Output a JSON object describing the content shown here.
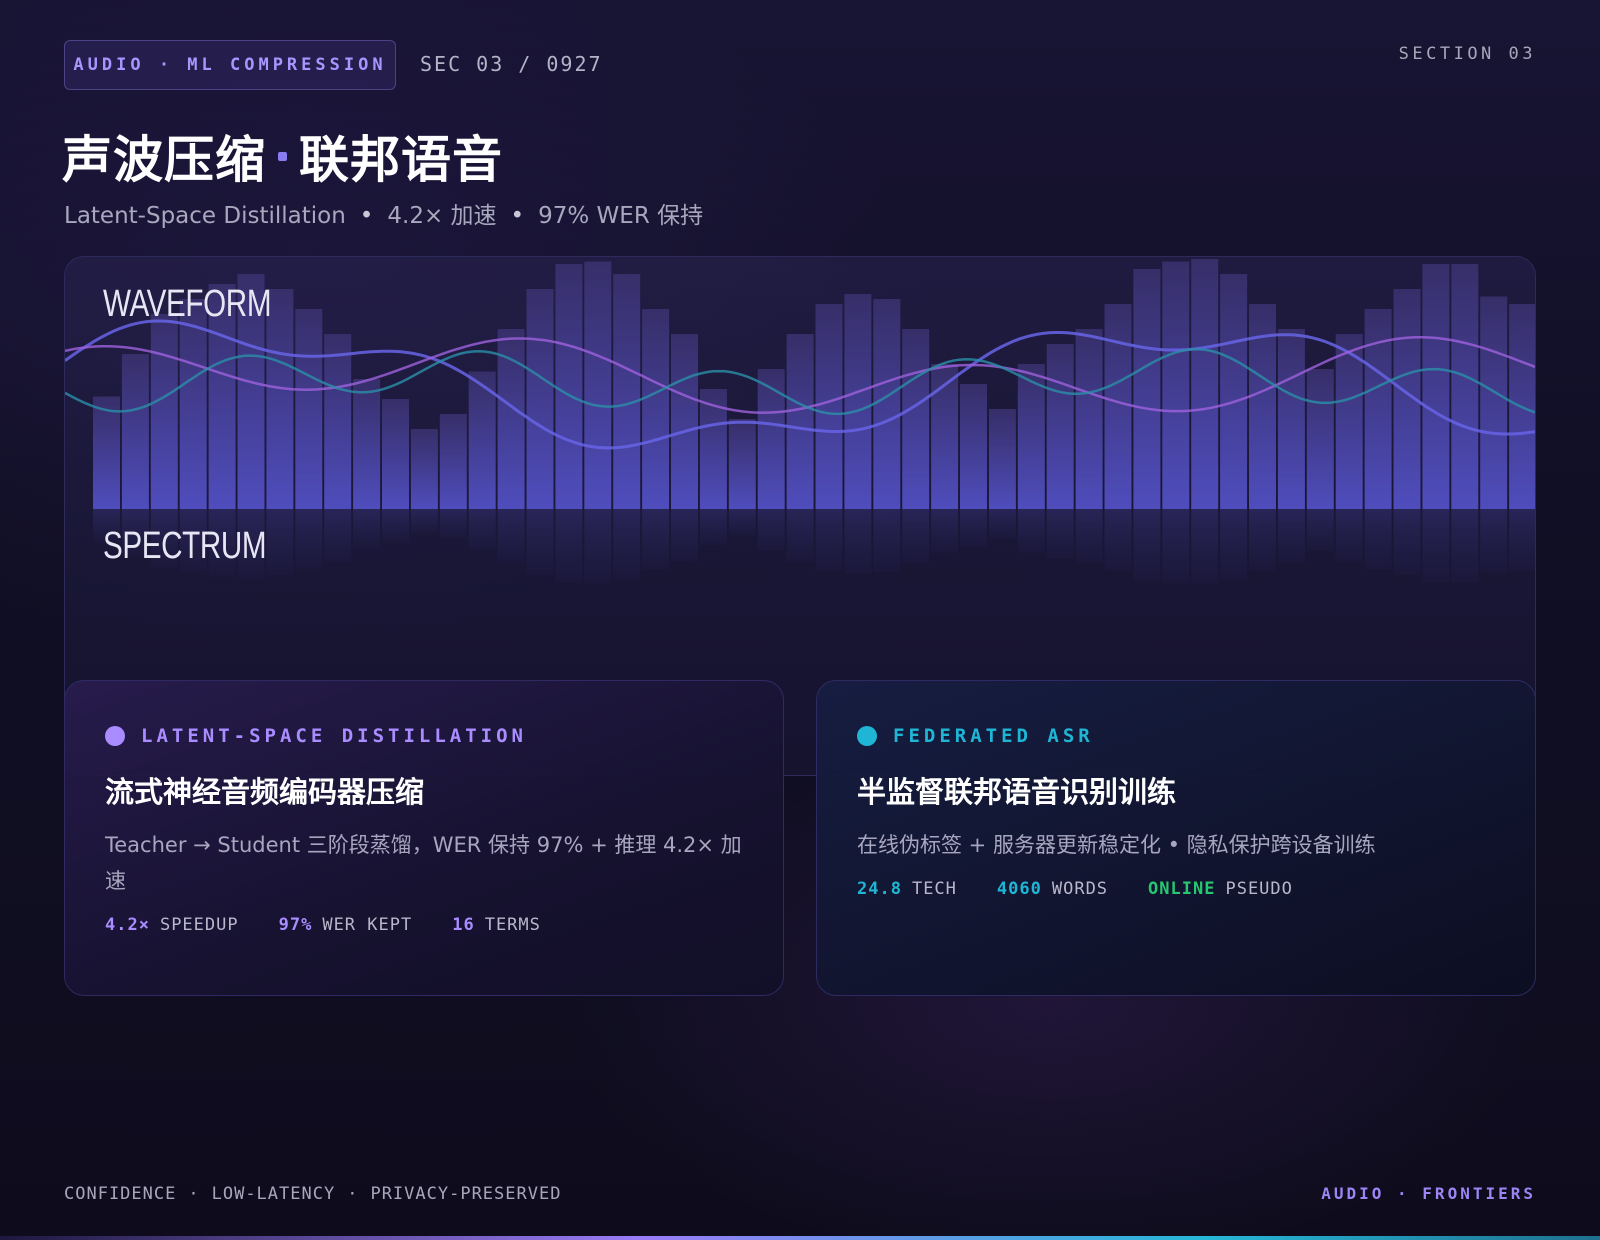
{
  "header": {
    "badge": "AUDIO · ML COMPRESSION",
    "sec_code": "SEC 03 / 0927",
    "section_label": "SECTION 03"
  },
  "title": {
    "part1": "声波压缩",
    "part2": "联邦语音"
  },
  "subtitle": {
    "items": [
      "Latent-Space Distillation",
      "4.2× 加速",
      "97% WER 保持"
    ],
    "separator": "•"
  },
  "visual": {
    "waveform_label": "WAVEFORM",
    "spectrum_label": "SPECTRUM",
    "colors": {
      "bar_bottom": "#4f4dbb",
      "bar_top": "#3b3270",
      "line_indigo": "#6764e6",
      "line_purple": "#9f61dd",
      "line_teal": "#2b8fa8"
    },
    "bar_levels": [
      0.45,
      0.62,
      0.78,
      0.84,
      0.9,
      0.94,
      0.88,
      0.8,
      0.7,
      0.52,
      0.44,
      0.32,
      0.38,
      0.55,
      0.72,
      0.88,
      0.98,
      0.99,
      0.94,
      0.8,
      0.7,
      0.48,
      0.36,
      0.56,
      0.7,
      0.82,
      0.86,
      0.84,
      0.72,
      0.58,
      0.5,
      0.4,
      0.58,
      0.66,
      0.72,
      0.82,
      0.96,
      0.99,
      1.0,
      0.94,
      0.82,
      0.72,
      0.56,
      0.7,
      0.8,
      0.88,
      0.98,
      0.98,
      0.85,
      0.82,
      0.82
    ]
  },
  "cards": [
    {
      "tag": "LATENT-SPACE DISTILLATION",
      "dot_color": "#a98cff",
      "tag_color": "#a98cff",
      "title": "流式神经音频编码器压缩",
      "desc": "Teacher → Student 三阶段蒸馏，WER 保持 97% + 推理 4.2× 加速",
      "stat_color": "#a98cff",
      "stats": [
        {
          "value": "4.2×",
          "label": "SPEEDUP"
        },
        {
          "value": "97%",
          "label": "WER KEPT"
        },
        {
          "value": "16",
          "label": "TERMS"
        }
      ]
    },
    {
      "tag": "FEDERATED ASR",
      "dot_color": "#1fb6d6",
      "tag_color": "#1fb6d6",
      "title": "半监督联邦语音识别训练",
      "desc": "在线伪标签 + 服务器更新稳定化 • 隐私保护跨设备训练",
      "stat_color": "#1fb6d6",
      "stats": [
        {
          "value": "24.8",
          "label": "TECH"
        },
        {
          "value": "4060",
          "label": "WORDS"
        },
        {
          "value": "ONLINE",
          "label": "PSEUDO",
          "color": "#27c76f"
        }
      ]
    }
  ],
  "footer": {
    "items": [
      "CONFIDENCE",
      "LOW-LATENCY",
      "PRIVACY-PRESERVED"
    ],
    "separator": "·",
    "brand": "AUDIO · FRONTIERS"
  }
}
